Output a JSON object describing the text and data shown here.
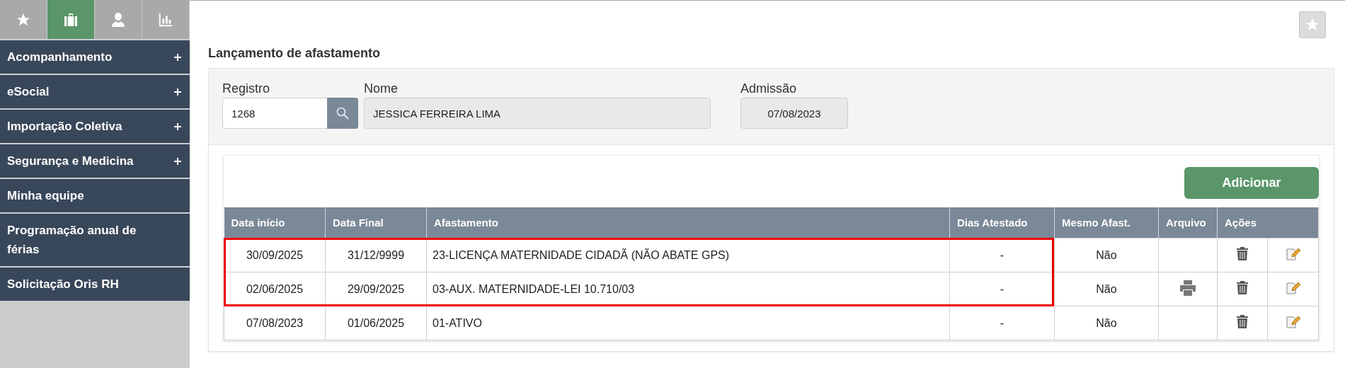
{
  "sidebar": {
    "tabs": [
      {
        "kind": "star",
        "selected": false
      },
      {
        "kind": "briefcase",
        "selected": true
      },
      {
        "kind": "user",
        "selected": false
      },
      {
        "kind": "chart",
        "selected": false
      }
    ],
    "items": [
      {
        "label": "Acompanhamento",
        "expandable": true
      },
      {
        "label": "eSocial",
        "expandable": true
      },
      {
        "label": "Importação Coletiva",
        "expandable": true
      },
      {
        "label": "Segurança e Medicina",
        "expandable": true
      },
      {
        "label": "Minha equipe",
        "expandable": false
      },
      {
        "label": "Programação anual de férias",
        "expandable": false
      },
      {
        "label": "Solicitação Oris RH",
        "expandable": false
      }
    ]
  },
  "page_title": "Lançamento de afastamento",
  "form": {
    "registro": {
      "label": "Registro",
      "value": "1268"
    },
    "nome": {
      "label": "Nome",
      "value": "JESSICA FERREIRA LIMA"
    },
    "admissao": {
      "label": "Admissão",
      "value": "07/08/2023"
    }
  },
  "table": {
    "add_button": "Adicionar",
    "columns": [
      "Data início",
      "Data Final",
      "Afastamento",
      "Dias Atestado",
      "Mesmo Afast.",
      "Arquivo",
      "Ações"
    ],
    "rows": [
      {
        "cells": [
          "30/09/2025",
          "31/12/9999",
          "23-LICENÇA MATERNIDADE CIDADÃ (NÃO ABATE GPS)",
          "-",
          "Não"
        ],
        "has_file": false,
        "highlighted": true
      },
      {
        "cells": [
          "02/06/2025",
          "29/09/2025",
          "03-AUX. MATERNIDADE-LEI 10.710/03",
          "-",
          "Não"
        ],
        "has_file": true,
        "highlighted": true
      },
      {
        "cells": [
          "07/08/2023",
          "01/06/2025",
          "01-ATIVO",
          "-",
          "Não"
        ],
        "has_file": false,
        "highlighted": false
      }
    ]
  }
}
